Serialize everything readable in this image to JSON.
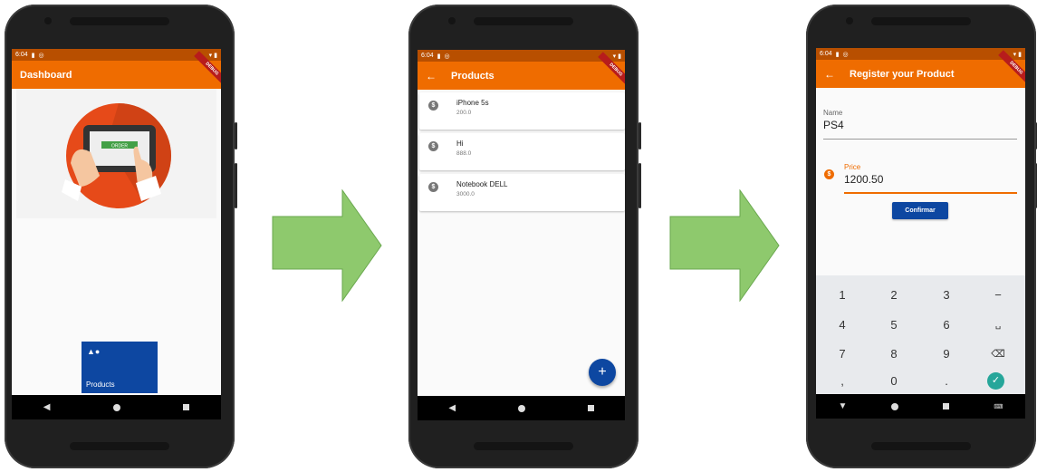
{
  "status": {
    "time": "6:04"
  },
  "screen1": {
    "appbar_title": "Dashboard",
    "hero_button": "ORDER",
    "tile": {
      "icon": "shapes-icon",
      "label": "Products"
    }
  },
  "screen2": {
    "appbar_title": "Products",
    "back_icon": "arrow-left-icon",
    "products": [
      {
        "name": "iPhone 5s",
        "price": "200.0"
      },
      {
        "name": "Hi",
        "price": "888.0"
      },
      {
        "name": "Notebook DELL",
        "price": "3000.0"
      }
    ],
    "fab_label": "+"
  },
  "screen3": {
    "appbar_title": "Register your Product",
    "name_label": "Name",
    "name_value": "PS4",
    "price_label": "Price",
    "price_value": "1200.50",
    "confirm_label": "Confirmar",
    "keys": [
      "1",
      "2",
      "3",
      "−",
      "4",
      "5",
      "6",
      "␣",
      "7",
      "8",
      "9",
      "⌫",
      ",",
      "0",
      "."
    ]
  },
  "colors": {
    "appbar": "#ef6c00",
    "statusbar": "#b84f00",
    "primary_button": "#0d47a1",
    "arrow": "#8ec96d"
  }
}
